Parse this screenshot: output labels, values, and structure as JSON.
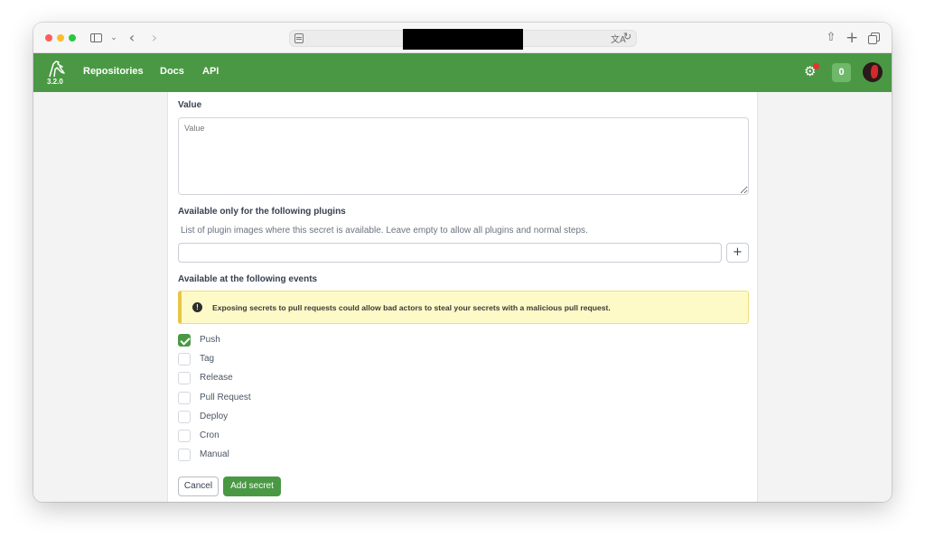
{
  "browser": {
    "toolbar_icons": [
      "sidebar-icon",
      "chevron-down-icon",
      "back-icon",
      "forward-icon",
      "reader-icon",
      "translate-icon",
      "reload-icon",
      "share-icon",
      "plus-icon",
      "tabs-icon"
    ]
  },
  "navbar": {
    "version": "3.2.0",
    "links": [
      "Repositories",
      "Docs",
      "API"
    ],
    "badge_count": "0",
    "accent_color": "#4a9844"
  },
  "form": {
    "value_label": "Value",
    "value_placeholder": "Value",
    "plugins_label": "Available only for the following plugins",
    "plugins_help": "List of plugin images where this secret is available. Leave empty to allow all plugins and normal steps.",
    "plugin_add": "+",
    "events_label": "Available at the following events",
    "warning": "Exposing secrets to pull requests could allow bad actors to steal your secrets with a malicious pull request.",
    "events": [
      {
        "label": "Push",
        "checked": true
      },
      {
        "label": "Tag",
        "checked": false
      },
      {
        "label": "Release",
        "checked": false
      },
      {
        "label": "Pull Request",
        "checked": false
      },
      {
        "label": "Deploy",
        "checked": false
      },
      {
        "label": "Cron",
        "checked": false
      },
      {
        "label": "Manual",
        "checked": false
      }
    ],
    "cancel_label": "Cancel",
    "submit_label": "Add secret"
  }
}
